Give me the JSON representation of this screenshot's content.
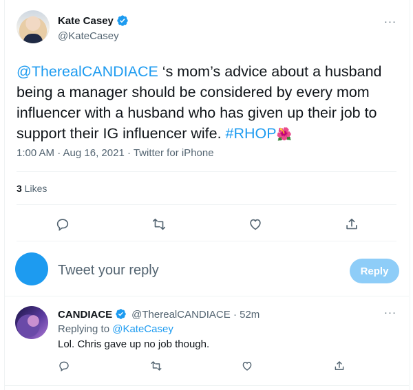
{
  "tweet": {
    "author_name": "Kate Casey",
    "author_handle": "@KateCasey",
    "more_label": "···",
    "text_parts": {
      "mention": "@TherealCANDIACE",
      "body": " ‘s mom’s advice about a husband being a manager should be considered by every mom influencer with a husband who has given up their job to support their IG influencer wife. ",
      "hashtag": "#RHOP",
      "emoji": "🌺"
    },
    "timestamp": "1:00 AM · Aug 16, 2021 · Twitter for iPhone",
    "likes_count": "3",
    "likes_label": " Likes"
  },
  "composer": {
    "placeholder": "Tweet your reply",
    "reply_button": "Reply"
  },
  "reply": {
    "author_name": "CANDIACE",
    "author_handle": "@TherealCANDIACE · 52m",
    "replying_prefix": "Replying to ",
    "replying_handle": "@KateCasey",
    "text": "Lol. Chris gave up no job though.",
    "more_label": "···"
  },
  "colors": {
    "accent": "#1d9bf0",
    "muted": "#536471",
    "reply_button_disabled": "#8ecdf8"
  },
  "icons": [
    "verified-badge-icon",
    "reply-icon",
    "retweet-icon",
    "like-icon",
    "share-icon",
    "more-icon"
  ]
}
